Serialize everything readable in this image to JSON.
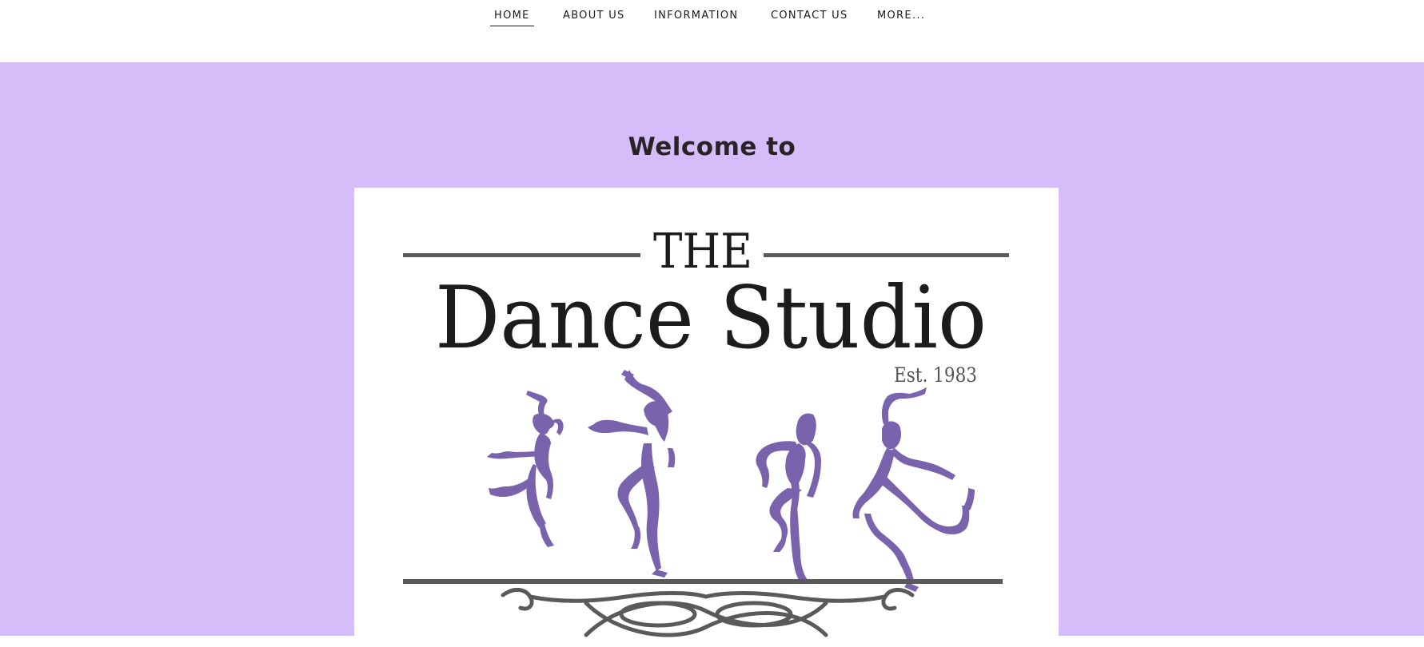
{
  "nav": {
    "items": [
      {
        "label": "HOME",
        "active": true
      },
      {
        "label": "ABOUT US",
        "active": false
      },
      {
        "label": "INFORMATION",
        "active": false
      },
      {
        "label": "CONTACT US",
        "active": false
      },
      {
        "label": "MORE..."
      }
    ]
  },
  "hero": {
    "heading": "Welcome to",
    "logo": {
      "line1": "THE",
      "line2": "Dance Studio",
      "established": "Est. 1983"
    }
  },
  "colors": {
    "hero_background": "#d5bdf9",
    "dancer_purple": "#7a63ad",
    "logo_rule_gray": "#5a5a5a",
    "heading_text": "#2a2326"
  },
  "icons": [
    "dancer-silhouette-icon",
    "flourish-ornament-icon"
  ]
}
